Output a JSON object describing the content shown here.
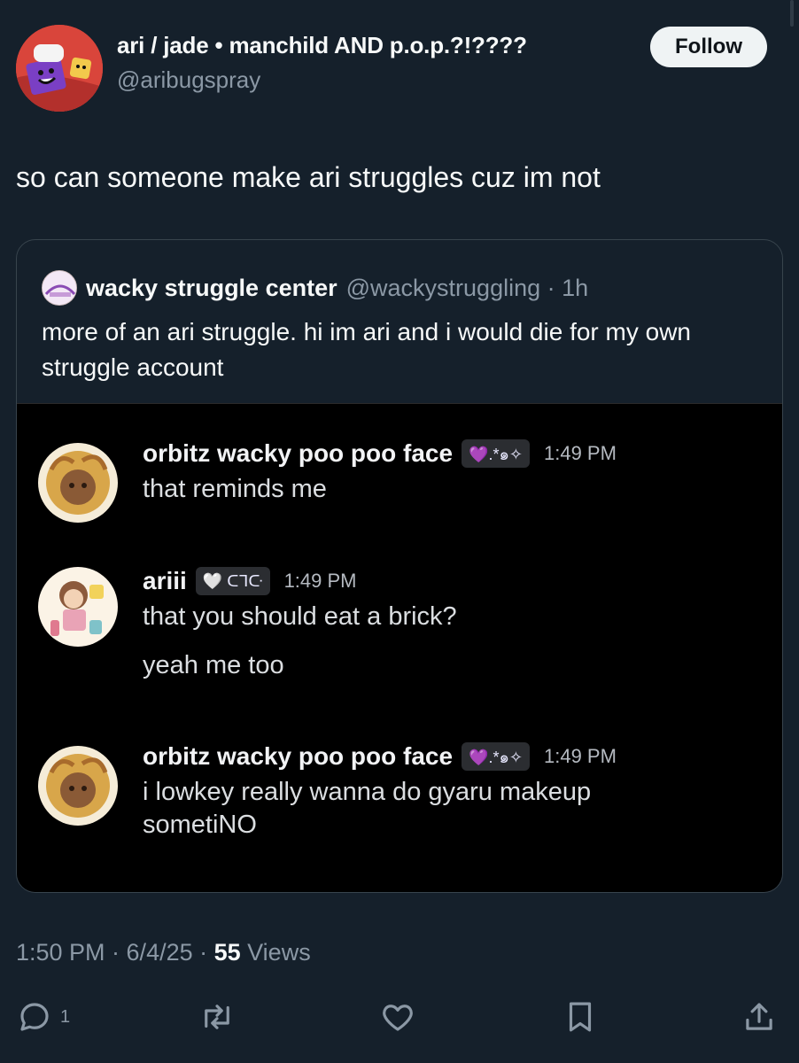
{
  "author": {
    "display_name": "ari / jade • manchild AND p.o.p.?!????",
    "handle": "@aribugspray",
    "follow_label": "Follow"
  },
  "tweet_text": "so can someone make ari struggles cuz im not",
  "quote": {
    "name": "wacky struggle center",
    "handle_time": "@wackystruggling · 1h",
    "text": "more of an ari struggle. hi im ari and i would die for my own struggle account"
  },
  "discord_messages": [
    {
      "user": "orbitz wacky poo poo face",
      "tag": "💜.*๑✧",
      "time": "1:49 PM",
      "lines": [
        "that reminds me"
      ]
    },
    {
      "user": "ariii",
      "tag": "🤍 ᑕᒣᑢ",
      "time": "1:49 PM",
      "lines": [
        "that you should eat a brick?",
        "yeah me too"
      ]
    },
    {
      "user": "orbitz wacky poo poo face",
      "tag": "💜.*๑✧",
      "time": "1:49 PM",
      "lines": [
        "i lowkey really wanna do gyaru makeup",
        "sometiNO"
      ]
    }
  ],
  "meta": {
    "time_date": "1:50 PM · 6/4/25 · ",
    "views_count": "55",
    "views_label": " Views"
  },
  "actions": {
    "reply_count": "1",
    "icons": [
      "reply-icon",
      "retweet-icon",
      "like-icon",
      "bookmark-icon",
      "share-icon"
    ]
  },
  "colors": {
    "background": "#15202b",
    "muted": "#8b98a5",
    "follow_bg": "#eff3f4",
    "discord_bg": "#000000"
  }
}
